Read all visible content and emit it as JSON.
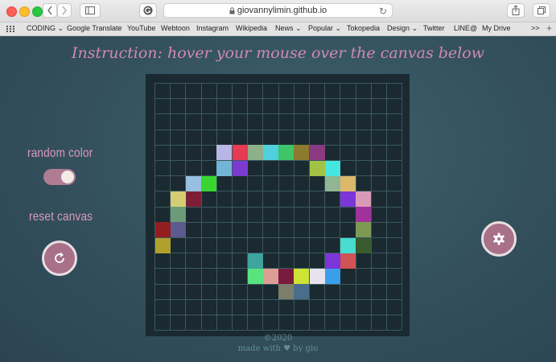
{
  "browser": {
    "url": "giovannylimin.github.io",
    "bookmarks": [
      {
        "label": "CODING",
        "dropdown": true
      },
      {
        "label": "Google Translate",
        "dropdown": false
      },
      {
        "label": "YouTube",
        "dropdown": false
      },
      {
        "label": "Webtoon",
        "dropdown": false
      },
      {
        "label": "Instagram",
        "dropdown": false
      },
      {
        "label": "Wikipedia",
        "dropdown": false
      },
      {
        "label": "News",
        "dropdown": true
      },
      {
        "label": "Popular",
        "dropdown": true
      },
      {
        "label": "Tokopedia",
        "dropdown": false
      },
      {
        "label": "Design",
        "dropdown": true
      },
      {
        "label": "Twitter",
        "dropdown": false
      },
      {
        "label": "LINE@",
        "dropdown": false
      },
      {
        "label": "My Drive",
        "dropdown": false
      }
    ],
    "overflow_label": ">>",
    "new_tab_label": "+"
  },
  "page": {
    "instruction": "Instruction: hover your mouse over the canvas below",
    "random_color_label": "random color",
    "random_color_on": true,
    "reset_canvas_label": "reset canvas",
    "footer_year": "©2020",
    "footer_credit": "made with ♥ by gio"
  },
  "canvas": {
    "columns": 16,
    "rows": 16,
    "background": "#1a2a30",
    "painted_cells": [
      {
        "col": 4,
        "row": 4,
        "color": "#b8b6e6"
      },
      {
        "col": 5,
        "row": 4,
        "color": "#e63a55"
      },
      {
        "col": 6,
        "row": 4,
        "color": "#8daf8a"
      },
      {
        "col": 7,
        "row": 4,
        "color": "#4fd0dc"
      },
      {
        "col": 8,
        "row": 4,
        "color": "#3fc46a"
      },
      {
        "col": 9,
        "row": 4,
        "color": "#8c7a2e"
      },
      {
        "col": 10,
        "row": 4,
        "color": "#8a3a80"
      },
      {
        "col": 4,
        "row": 5,
        "color": "#73b5d6"
      },
      {
        "col": 5,
        "row": 5,
        "color": "#7c3bd0"
      },
      {
        "col": 10,
        "row": 5,
        "color": "#a2c245"
      },
      {
        "col": 11,
        "row": 5,
        "color": "#45e5e0"
      },
      {
        "col": 2,
        "row": 6,
        "color": "#98c0e0"
      },
      {
        "col": 3,
        "row": 6,
        "color": "#39d631"
      },
      {
        "col": 11,
        "row": 6,
        "color": "#91b693"
      },
      {
        "col": 12,
        "row": 6,
        "color": "#dcb86a"
      },
      {
        "col": 1,
        "row": 7,
        "color": "#d4cd73"
      },
      {
        "col": 2,
        "row": 7,
        "color": "#7c1f36"
      },
      {
        "col": 12,
        "row": 7,
        "color": "#7c35d8"
      },
      {
        "col": 13,
        "row": 7,
        "color": "#d99ab7"
      },
      {
        "col": 1,
        "row": 8,
        "color": "#6d9b79"
      },
      {
        "col": 13,
        "row": 8,
        "color": "#a0339b"
      },
      {
        "col": 0,
        "row": 9,
        "color": "#931e20"
      },
      {
        "col": 1,
        "row": 9,
        "color": "#5c5a8e"
      },
      {
        "col": 13,
        "row": 9,
        "color": "#7d9a55"
      },
      {
        "col": 0,
        "row": 10,
        "color": "#b2a02d"
      },
      {
        "col": 12,
        "row": 10,
        "color": "#47dccf"
      },
      {
        "col": 13,
        "row": 10,
        "color": "#3a5a2f"
      },
      {
        "col": 6,
        "row": 11,
        "color": "#3fa49b"
      },
      {
        "col": 11,
        "row": 11,
        "color": "#7c35d8"
      },
      {
        "col": 12,
        "row": 11,
        "color": "#cf5254"
      },
      {
        "col": 6,
        "row": 12,
        "color": "#58e37c"
      },
      {
        "col": 7,
        "row": 12,
        "color": "#dd9e96"
      },
      {
        "col": 8,
        "row": 12,
        "color": "#7a1a3e"
      },
      {
        "col": 9,
        "row": 12,
        "color": "#cde335"
      },
      {
        "col": 10,
        "row": 12,
        "color": "#e7e3ee"
      },
      {
        "col": 11,
        "row": 12,
        "color": "#3a9fe8"
      },
      {
        "col": 8,
        "row": 13,
        "color": "#7a7e6a"
      },
      {
        "col": 9,
        "row": 13,
        "color": "#4a6d8c"
      }
    ]
  },
  "colors": {
    "accent_pink": "#d08ab0",
    "button_fill": "#a87089"
  }
}
